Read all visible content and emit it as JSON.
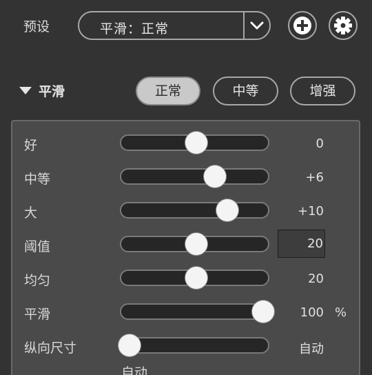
{
  "preset": {
    "label": "预设",
    "selected": "平滑：正常",
    "icons": [
      "chevron-down-icon",
      "plus-icon",
      "gear-icon"
    ]
  },
  "section": {
    "title": "平滑",
    "modes": [
      "正常",
      "中等",
      "增强"
    ],
    "active_mode": "正常"
  },
  "sliders": [
    {
      "label": "好",
      "value": "0",
      "level": 0.5
    },
    {
      "label": "中等",
      "value": "+6",
      "level": 0.64
    },
    {
      "label": "大",
      "value": "+10",
      "level": 0.73
    },
    {
      "label": "阈值",
      "value": "20",
      "level": 0.5
    },
    {
      "label": "均匀",
      "value": "20",
      "level": 0.5
    },
    {
      "label": "平滑",
      "value": "100",
      "unit": "%",
      "level": 1.0
    },
    {
      "label": "纵向尺寸",
      "value": "自动",
      "level": 0.0
    }
  ],
  "below_label": "自动",
  "colors": {
    "background": "#333333",
    "panel": "#4a4a4a",
    "track": "#262626",
    "knob": "#f4f4f4",
    "active_button": "#c9c9c9"
  }
}
